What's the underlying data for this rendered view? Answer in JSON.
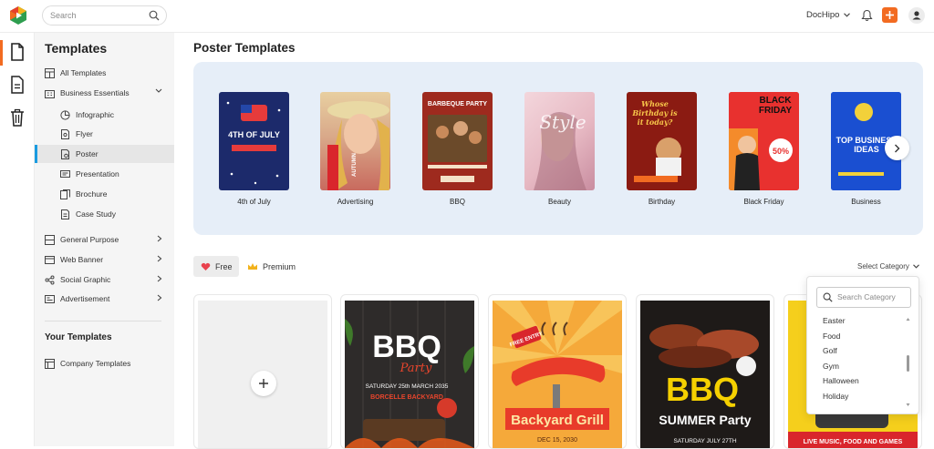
{
  "topbar": {
    "search_placeholder": "Search",
    "account_name": "DocHipo"
  },
  "sidebar": {
    "title": "Templates",
    "items": [
      {
        "label": "All Templates"
      },
      {
        "label": "Business Essentials"
      },
      {
        "label": "Infographic"
      },
      {
        "label": "Flyer"
      },
      {
        "label": "Poster",
        "selected": true
      },
      {
        "label": "Presentation"
      },
      {
        "label": "Brochure"
      },
      {
        "label": "Case Study"
      },
      {
        "label": "General Purpose"
      },
      {
        "label": "Web Banner"
      },
      {
        "label": "Social Graphic"
      },
      {
        "label": "Advertisement"
      }
    ],
    "your_templates_title": "Your Templates",
    "company_templates": "Company Templates"
  },
  "main": {
    "title": "Poster Templates",
    "categories": [
      {
        "label": "4th of July",
        "thumb_text": "4TH OF JULY"
      },
      {
        "label": "Advertising",
        "thumb_text": "AUTUMN"
      },
      {
        "label": "BBQ",
        "thumb_text": "BARBEQUE PARTY"
      },
      {
        "label": "Beauty",
        "thumb_text": "Style"
      },
      {
        "label": "Birthday",
        "thumb_text": "Whose Birthday is it today?"
      },
      {
        "label": "Black Friday",
        "thumb_text": "BLACK FRIDAY"
      },
      {
        "label": "Business",
        "thumb_text": "TOP BUSINESS IDEAS"
      }
    ],
    "filters": {
      "free": "Free",
      "premium": "Premium"
    },
    "select_category": "Select Category",
    "tiles": [
      {
        "headline": "BBQ",
        "sub": "Party",
        "detail": "SATURDAY 25th MARCH 2035",
        "venue": "BORCELLE BACKYARD"
      },
      {
        "headline": "Backyard Grill",
        "sub": "FREE ENTRY",
        "detail": "DEC 15, 2030"
      },
      {
        "headline": "BBQ",
        "sub": "SUMMER Party",
        "detail": "SATURDAY JULY 27TH"
      },
      {
        "headline": "LIVE MUSIC, FOOD AND GAMES"
      }
    ]
  },
  "category_dropdown": {
    "search_placeholder": "Search Category",
    "options": [
      "Easter",
      "Food",
      "Golf",
      "Gym",
      "Halloween",
      "Holiday"
    ]
  },
  "colors": {
    "accent": "#f26b21",
    "selected_marker": "#1a9be0",
    "carousel_bg": "#e6eef8"
  }
}
